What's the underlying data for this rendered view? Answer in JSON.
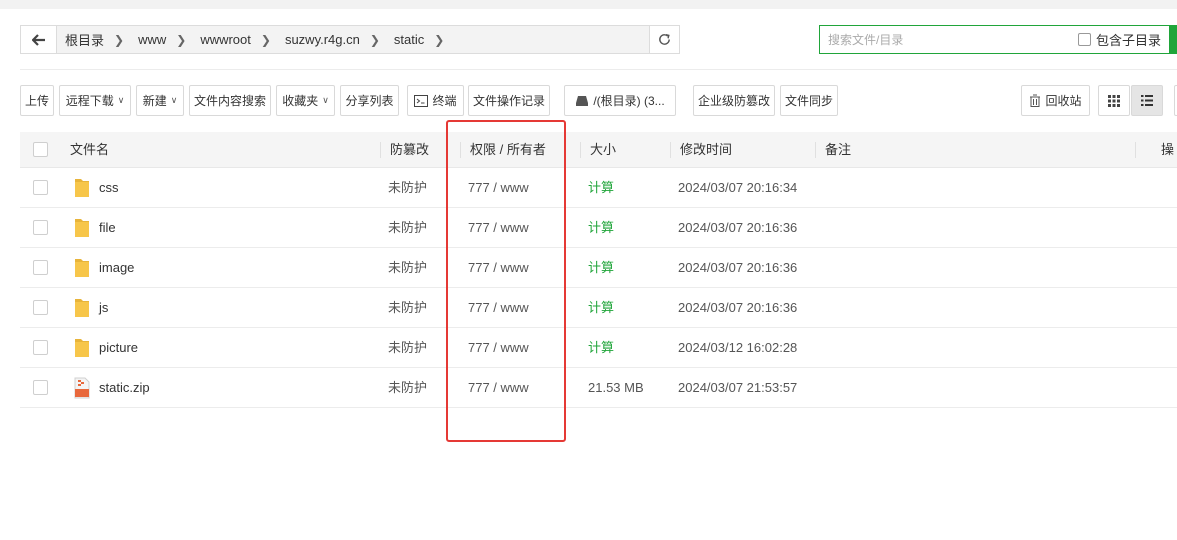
{
  "breadcrumb": {
    "items": [
      "根目录",
      "www",
      "wwwroot",
      "suzwy.r4g.cn",
      "static"
    ]
  },
  "search": {
    "placeholder": "搜索文件/目录",
    "include_sub_label": "包含子目录"
  },
  "toolbar": {
    "upload": "上传",
    "remote_download": "远程下载",
    "new": "新建",
    "content_search": "文件内容搜索",
    "favorites": "收藏夹",
    "share_list": "分享列表",
    "terminal": "终端",
    "file_log": "文件操作记录",
    "disk": "/(根目录) (3...",
    "tamper_proof": "企业级防篡改",
    "file_sync": "文件同步",
    "recycle_bin": "回收站"
  },
  "table": {
    "headers": {
      "name": "文件名",
      "tamper": "防篡改",
      "perm": "权限 / 所有者",
      "size": "大小",
      "mtime": "修改时间",
      "remark": "备注",
      "ops": "操"
    },
    "rows": [
      {
        "type": "folder",
        "name": "css",
        "tamper": "未防护",
        "perm": "777 / www",
        "size": "计算",
        "mtime": "2024/03/07 20:16:34"
      },
      {
        "type": "folder",
        "name": "file",
        "tamper": "未防护",
        "perm": "777 / www",
        "size": "计算",
        "mtime": "2024/03/07 20:16:36"
      },
      {
        "type": "folder",
        "name": "image",
        "tamper": "未防护",
        "perm": "777 / www",
        "size": "计算",
        "mtime": "2024/03/07 20:16:36"
      },
      {
        "type": "folder",
        "name": "js",
        "tamper": "未防护",
        "perm": "777 / www",
        "size": "计算",
        "mtime": "2024/03/07 20:16:36"
      },
      {
        "type": "folder",
        "name": "picture",
        "tamper": "未防护",
        "perm": "777 / www",
        "size": "计算",
        "mtime": "2024/03/12 16:02:28"
      },
      {
        "type": "zip",
        "name": "static.zip",
        "tamper": "未防护",
        "perm": "777 / www",
        "size": "21.53 MB",
        "mtime": "2024/03/07 21:53:57"
      }
    ]
  },
  "colors": {
    "accent": "#20a53a",
    "highlight": "#e53935",
    "folder": "#f7c64a"
  }
}
